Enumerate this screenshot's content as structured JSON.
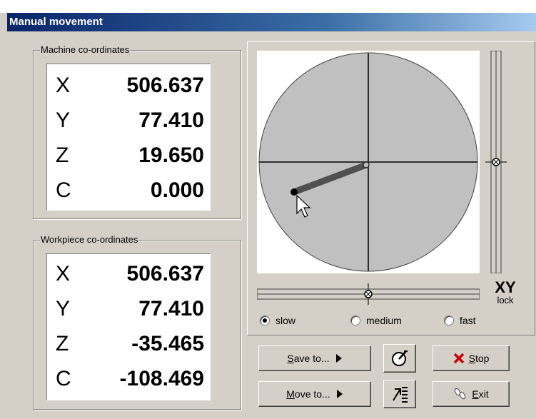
{
  "window": {
    "title": "Manual movement"
  },
  "machine": {
    "title": "Machine co-ordinates",
    "rows": [
      {
        "axis": "X",
        "value": "506.637"
      },
      {
        "axis": "Y",
        "value": "77.410"
      },
      {
        "axis": "Z",
        "value": "19.650"
      },
      {
        "axis": "C",
        "value": "0.000"
      }
    ]
  },
  "workpiece": {
    "title": "Workpiece co-ordinates",
    "rows": [
      {
        "axis": "X",
        "value": "506.637"
      },
      {
        "axis": "Y",
        "value": "77.410"
      },
      {
        "axis": "Z",
        "value": "-35.465"
      },
      {
        "axis": "C",
        "value": "-108.469"
      }
    ]
  },
  "joystick": {
    "lock_big": "XY",
    "lock_small": "lock"
  },
  "speed": {
    "options": [
      "slow",
      "medium",
      "fast"
    ],
    "selected": "slow"
  },
  "buttons": {
    "save_prefix": "S",
    "save_rest": "ave to...",
    "move_prefix": "M",
    "move_rest": "ove to...",
    "stop_prefix": "S",
    "stop_rest": "top",
    "exit_prefix": "E",
    "exit_rest": "xit"
  },
  "icons": {
    "save_arrow": "triangle-right-icon",
    "move_arrow": "triangle-right-icon",
    "stop_icon": "red-x-icon",
    "exit_icon": "footprints-icon",
    "dial_icon": "dial-icon",
    "list_icon": "list-arrow-icon"
  }
}
